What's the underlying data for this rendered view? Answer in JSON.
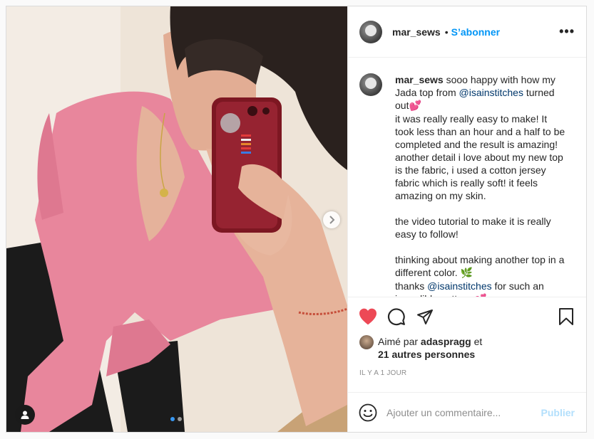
{
  "post": {
    "username": "mar_sews",
    "separator": "•",
    "follow_label": "S’abonner",
    "more_icon": "•••"
  },
  "caption": {
    "username": "mar_sews",
    "text_before_mention": " sooo happy with how my Jada top from ",
    "mention_1": "@isainstitches",
    "text_after_mention": " turned out",
    "emoji_1": "💕",
    "body": "\nit was really really easy to make! It took less than an hour and a half to be completed and the result is amazing!\nanother detail i love about my new top is the fabric, i used a cotton jersey fabric which is really soft! it feels amazing on my skin.\n\nthe video tutorial to make it is really easy to follow!\n\nthinking about making another top in a different color. ",
    "emoji_2": "🌿",
    "thanks_prefix": "\nthanks ",
    "mention_2": "@isainstitches",
    "thanks_suffix": " for such an incredible pattern ",
    "emoji_3": "💕"
  },
  "likes": {
    "prefix": "Aimé par ",
    "first_liker": "adaspragg",
    "conjunction": " et",
    "others": "21 autres personnes"
  },
  "timestamp": "IL Y A 1 JOUR",
  "comment_input": {
    "placeholder": "Ajouter un commentaire...",
    "value": ""
  },
  "post_button_label": "Publier",
  "carousel": {
    "slide_count": 2,
    "active_index": 0
  },
  "colors": {
    "like_red": "#ed4956",
    "follow_blue": "#0095f6",
    "mention_blue": "#00376b",
    "disabled_post_blue": "#b2dffc",
    "active_dot": "#3897f0"
  },
  "icons": {
    "like": "heart-filled-icon",
    "comment": "comment-bubble-icon",
    "share": "paper-plane-icon",
    "save": "bookmark-icon",
    "emoji": "smiley-icon",
    "next": "chevron-right-icon",
    "user_tag": "person-icon"
  }
}
